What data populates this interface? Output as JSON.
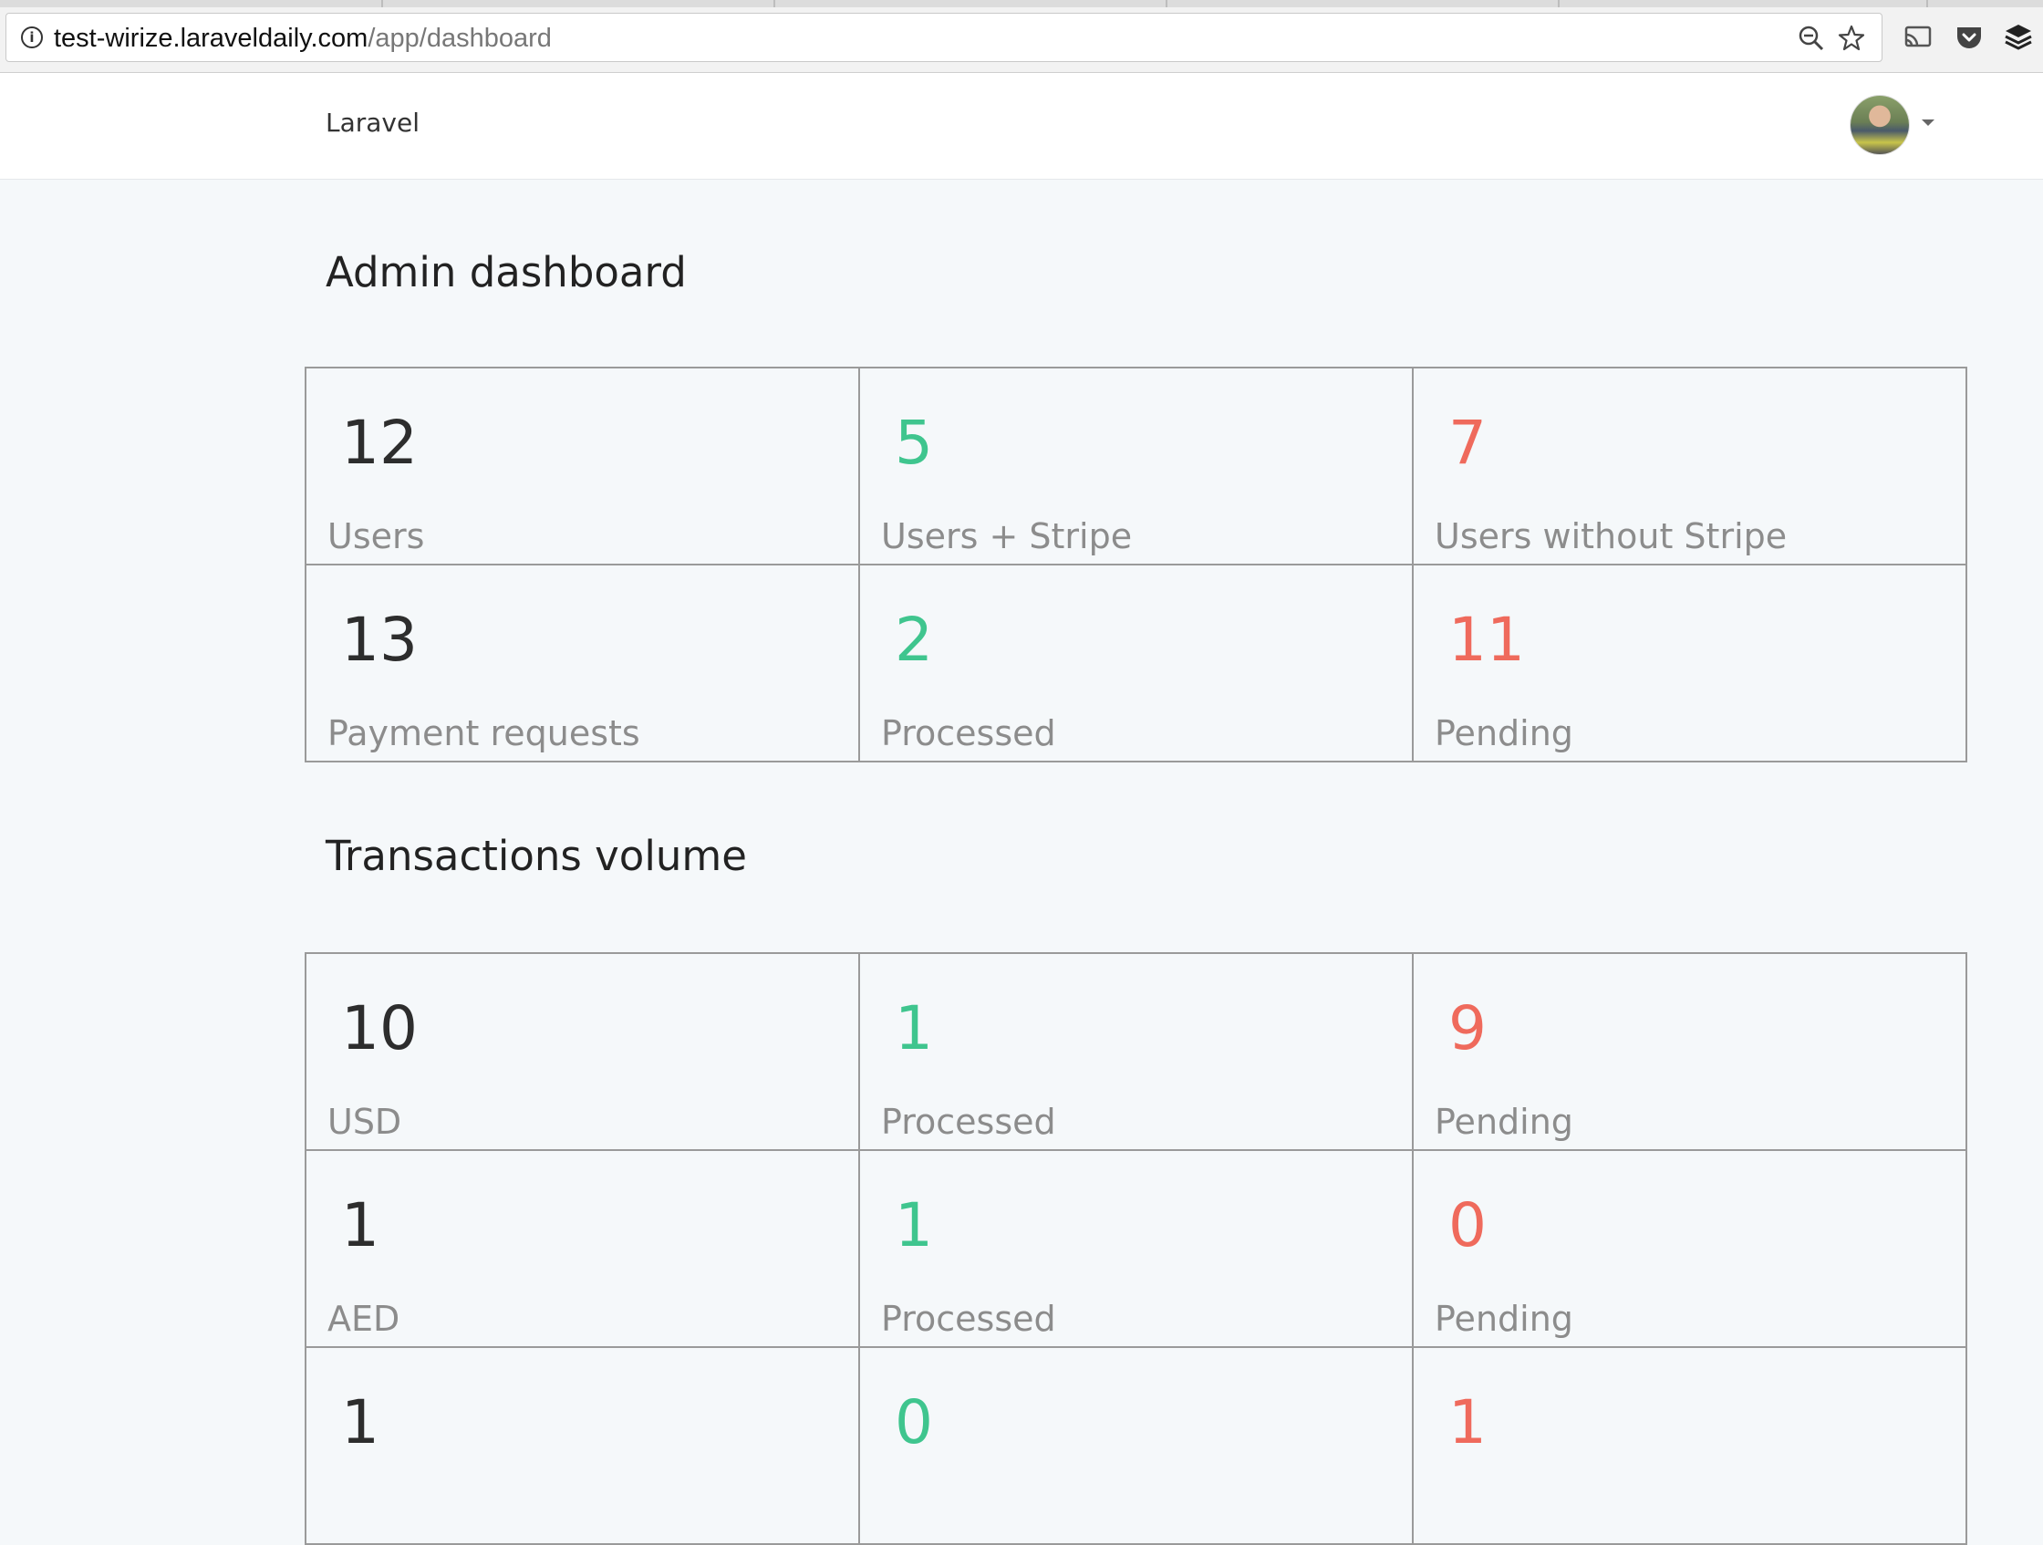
{
  "browser": {
    "url_host": "test-wirize.laraveldaily.com",
    "url_path": "/app/dashboard"
  },
  "navbar": {
    "brand": "Laravel"
  },
  "colors": {
    "neutral": "#2d2d2d",
    "positive": "#3fc58e",
    "negative": "#ef6a5c"
  },
  "admin_dashboard": {
    "title": "Admin dashboard",
    "rows": [
      [
        {
          "value": "12",
          "label": "Users",
          "tone": "neutral"
        },
        {
          "value": "5",
          "label": "Users + Stripe",
          "tone": "positive"
        },
        {
          "value": "7",
          "label": "Users without Stripe",
          "tone": "negative"
        }
      ],
      [
        {
          "value": "13",
          "label": "Payment requests",
          "tone": "neutral"
        },
        {
          "value": "2",
          "label": "Processed",
          "tone": "positive"
        },
        {
          "value": "11",
          "label": "Pending",
          "tone": "negative"
        }
      ]
    ]
  },
  "transactions_volume": {
    "title": "Transactions volume",
    "rows": [
      [
        {
          "value": "10",
          "label": "USD",
          "tone": "neutral"
        },
        {
          "value": "1",
          "label": "Processed",
          "tone": "positive"
        },
        {
          "value": "9",
          "label": "Pending",
          "tone": "negative"
        }
      ],
      [
        {
          "value": "1",
          "label": "AED",
          "tone": "neutral"
        },
        {
          "value": "1",
          "label": "Processed",
          "tone": "positive"
        },
        {
          "value": "0",
          "label": "Pending",
          "tone": "negative"
        }
      ],
      [
        {
          "value": "1",
          "label": "",
          "tone": "neutral"
        },
        {
          "value": "0",
          "label": "",
          "tone": "positive"
        },
        {
          "value": "1",
          "label": "",
          "tone": "negative"
        }
      ]
    ]
  }
}
